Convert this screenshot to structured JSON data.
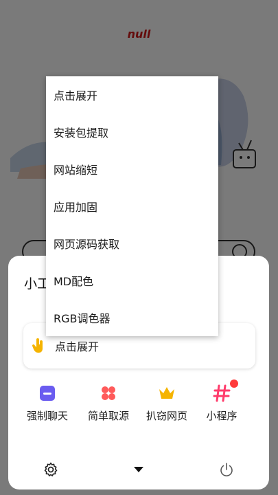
{
  "app": {
    "header_text": "null"
  },
  "sheet": {
    "title": "小工具",
    "expand_card_label": "点击展开",
    "tools": [
      {
        "label": "强制聊天",
        "icon": "chat-square-icon",
        "color": "#6a5cf0"
      },
      {
        "label": "简单取源",
        "icon": "dots-grid-icon",
        "color": "#ff5a5a"
      },
      {
        "label": "扒窃网页",
        "icon": "crown-icon",
        "color": "#f5b400"
      },
      {
        "label": "小程序",
        "icon": "hash-icon",
        "color": "#ff3b6b",
        "has_badge": true
      }
    ],
    "bottom_icons": [
      "gear-icon",
      "caret-down-icon",
      "power-icon"
    ]
  },
  "menu": {
    "items": [
      {
        "label": "点击展开"
      },
      {
        "label": "安装包提取"
      },
      {
        "label": "网站缩短"
      },
      {
        "label": "应用加固"
      },
      {
        "label": "网页源码获取"
      },
      {
        "label": "MD配色"
      },
      {
        "label": "RGB调色器"
      }
    ]
  }
}
